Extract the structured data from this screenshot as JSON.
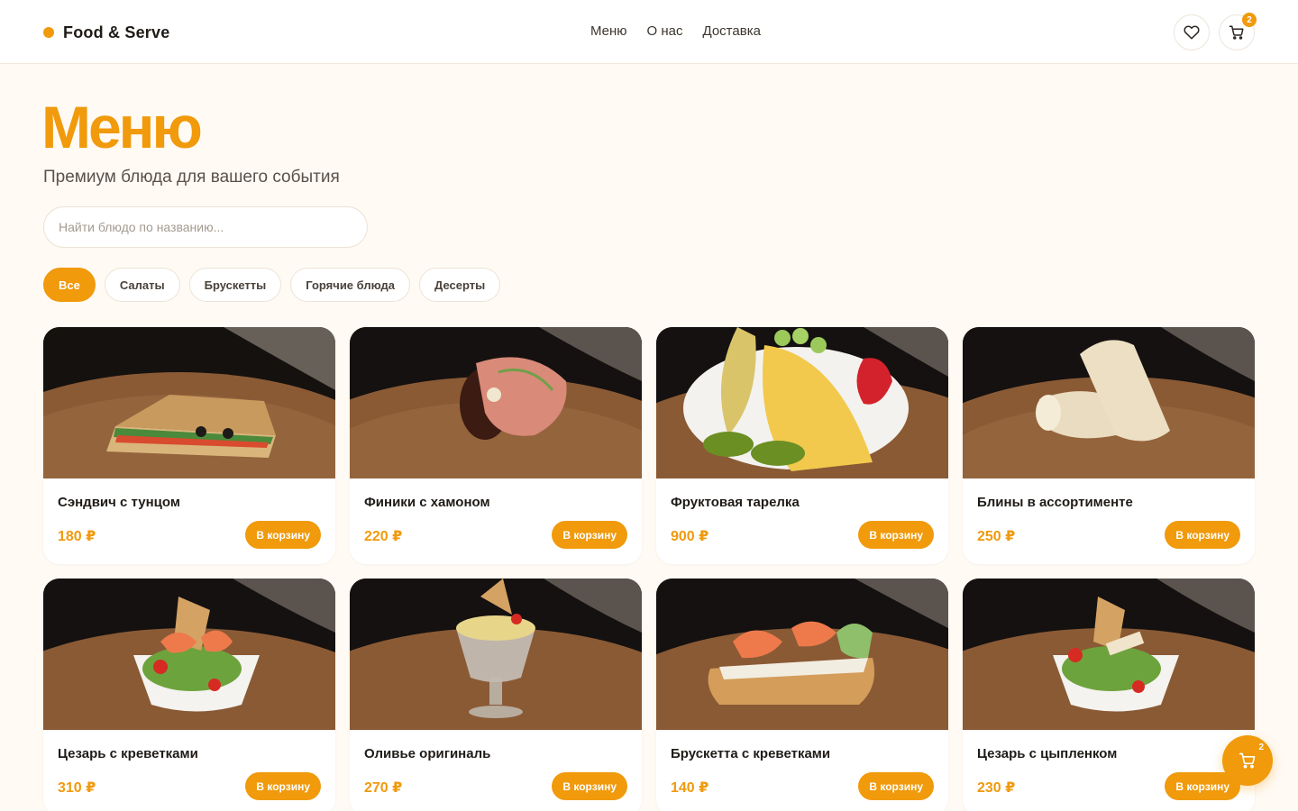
{
  "header": {
    "brand": "Food & Serve",
    "nav": [
      "Меню",
      "О нас",
      "Доставка"
    ],
    "cart_count": "2",
    "accent": "#f09a0c"
  },
  "main": {
    "title": "Меню",
    "subtitle": "Премиум блюда для вашего события",
    "search_placeholder": "Найти блюдо по названию...",
    "filters": [
      "Все",
      "Салаты",
      "Брускетты",
      "Горячие блюда",
      "Десерты"
    ],
    "active_filter": "Все",
    "add_label": "В корзину",
    "products": [
      {
        "name": "Сэндвич с тунцом",
        "price": "180 ₽",
        "dish": "sandwich"
      },
      {
        "name": "Финики с хамоном",
        "price": "220 ₽",
        "dish": "dates-jamon"
      },
      {
        "name": "Фруктовая тарелка",
        "price": "900 ₽",
        "dish": "fruit-plate"
      },
      {
        "name": "Блины в ассортименте",
        "price": "250 ₽",
        "dish": "crepes"
      },
      {
        "name": "Цезарь с креветками",
        "price": "310 ₽",
        "dish": "caesar-shrimp"
      },
      {
        "name": "Оливье оригиналь",
        "price": "270 ₽",
        "dish": "olivier"
      },
      {
        "name": "Брускетта с креветками",
        "price": "140 ₽",
        "dish": "bruschetta-shrimp"
      },
      {
        "name": "Цезарь с цыпленком",
        "price": "230 ₽",
        "dish": "caesar-chicken"
      }
    ]
  },
  "floating_cart": {
    "count": "2"
  }
}
